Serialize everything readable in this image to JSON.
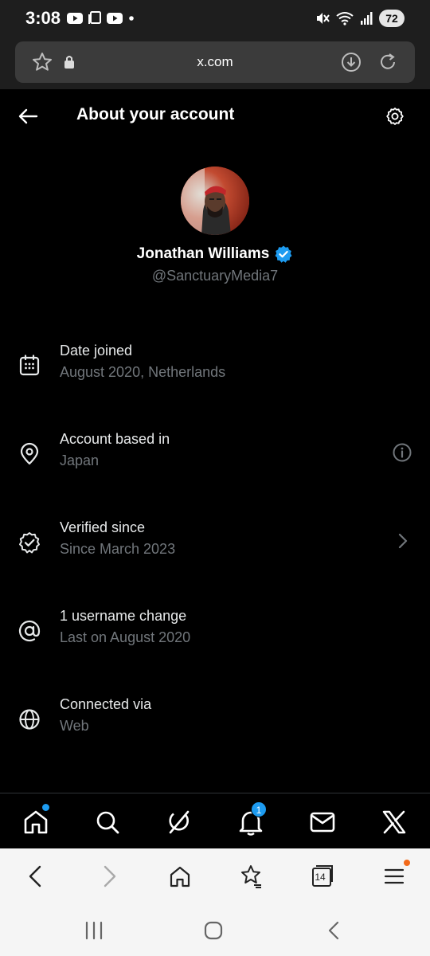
{
  "status_bar": {
    "time": "3:08",
    "battery": "72"
  },
  "browser": {
    "url": "x.com",
    "tab_count": "14"
  },
  "header": {
    "title": "About your account"
  },
  "profile": {
    "display_name": "Jonathan Williams",
    "handle": "@SanctuaryMedia7",
    "verified": true,
    "accent_color": "#1d9bf0"
  },
  "info_items": [
    {
      "icon": "calendar-icon",
      "title": "Date joined",
      "subtitle": "August 2020, Netherlands"
    },
    {
      "icon": "location-pin-icon",
      "title": "Account based in",
      "subtitle": "Japan",
      "right_icon": "info-icon"
    },
    {
      "icon": "verified-badge-icon",
      "title": "Verified since",
      "subtitle": "Since March 2023",
      "right_icon": "chevron-right-icon"
    },
    {
      "icon": "at-sign-icon",
      "title": "1 username change",
      "subtitle": "Last on August 2020"
    },
    {
      "icon": "globe-icon",
      "title": "Connected via",
      "subtitle": "Web"
    }
  ],
  "bottom_nav": {
    "items": [
      "home-icon",
      "search-icon",
      "grok-icon",
      "notifications-icon",
      "messages-icon",
      "x-logo-icon"
    ],
    "notification_count": "1"
  },
  "colors": {
    "background": "#000000",
    "secondary_text": "#71767b",
    "badge": "#1d9bf0",
    "menu_dot": "#f36a1a"
  }
}
